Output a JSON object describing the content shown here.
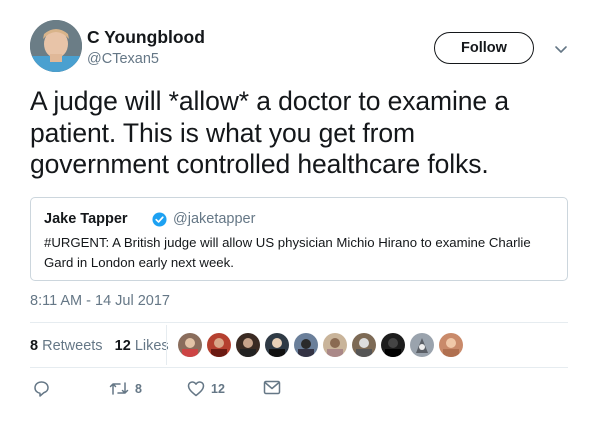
{
  "author": {
    "name": "C Youngblood",
    "handle": "@CTexan5",
    "avatar_icon": "profile-photo"
  },
  "follow_label": "Follow",
  "tweet": {
    "lines": [
      "A judge will *allow* a doctor to examine a",
      "patient. This is what you get from",
      "government controlled healthcare folks."
    ]
  },
  "quoted": {
    "name": "Jake Tapper",
    "handle": "@jaketapper",
    "lines": [
      "#URGENT: A British judge will allow US physician Michio Hirano to examine Charlie",
      "Gard in London early next week."
    ]
  },
  "timestamp": "8:11 AM - 14 Jul 2017",
  "stats": {
    "retweets_count": "8",
    "retweets_label": "Retweets",
    "likes_count": "12",
    "likes_label": "Likes"
  },
  "likers_colors": [
    "#8a6d5c",
    "#b5402f",
    "#3a2a22",
    "#2f3a45",
    "#6a7f9a",
    "#c9b49a",
    "#7d6a55",
    "#1d1d1d",
    "#9aa3ad",
    "#c98a6a"
  ],
  "actions": {
    "reply_icon": "reply-icon",
    "retweet_count": "8",
    "like_count": "12",
    "dm_icon": "envelope-icon"
  },
  "colors": {
    "text": "#14171a",
    "secondary": "#657786",
    "border": "#ccd6dd",
    "verified": "#1da1f2"
  }
}
